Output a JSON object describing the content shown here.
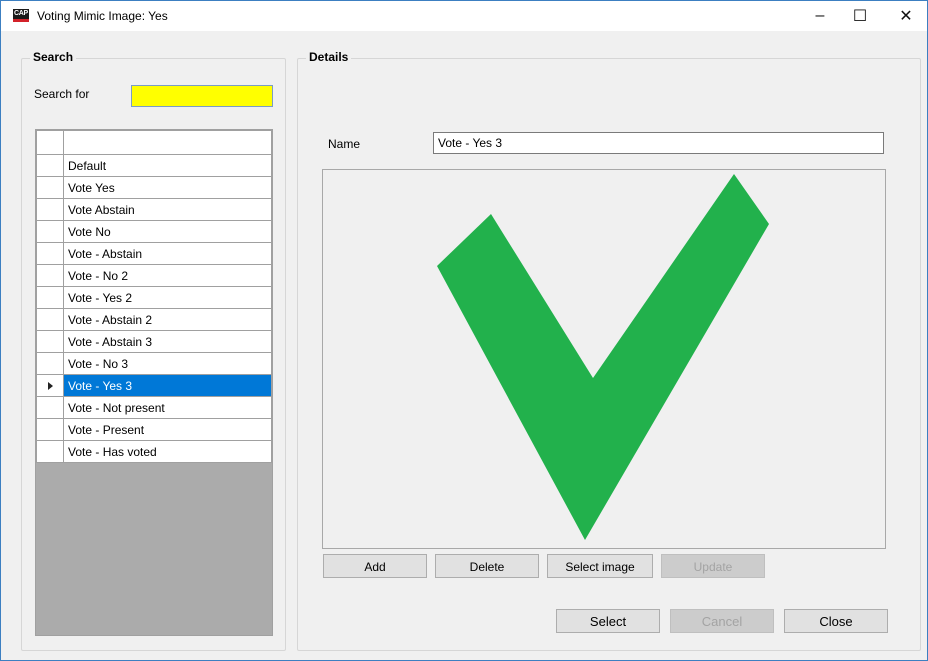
{
  "window": {
    "title": "Voting Mimic Image: Yes",
    "icon_text": "CAP",
    "minimize": "–",
    "maximize": "☐",
    "close": "✕"
  },
  "search": {
    "group_title": "Search",
    "label": "Search for",
    "value": "",
    "input_color": "#ffff00",
    "rows": [
      "Default",
      "Vote Yes",
      "Vote Abstain",
      "Vote No",
      "Vote - Abstain",
      "Vote - No 2",
      "Vote - Yes 2",
      "Vote - Abstain 2",
      "Vote - Abstain 3",
      "Vote - No 3",
      "Vote - Yes 3",
      "Vote - Not present",
      "Vote - Present",
      "Vote - Has voted"
    ],
    "selected_index": 10
  },
  "details": {
    "group_title": "Details",
    "name_label": "Name",
    "name_value": "Vote - Yes 3",
    "image": {
      "icon": "green-checkmark",
      "color": "#22b14c"
    },
    "buttons": {
      "add": "Add",
      "delete": "Delete",
      "select_image": "Select image",
      "update": "Update"
    }
  },
  "footer": {
    "select": "Select",
    "cancel": "Cancel",
    "close": "Close"
  },
  "colors": {
    "selection": "#0078d7",
    "window_border": "#3c7fc1"
  }
}
